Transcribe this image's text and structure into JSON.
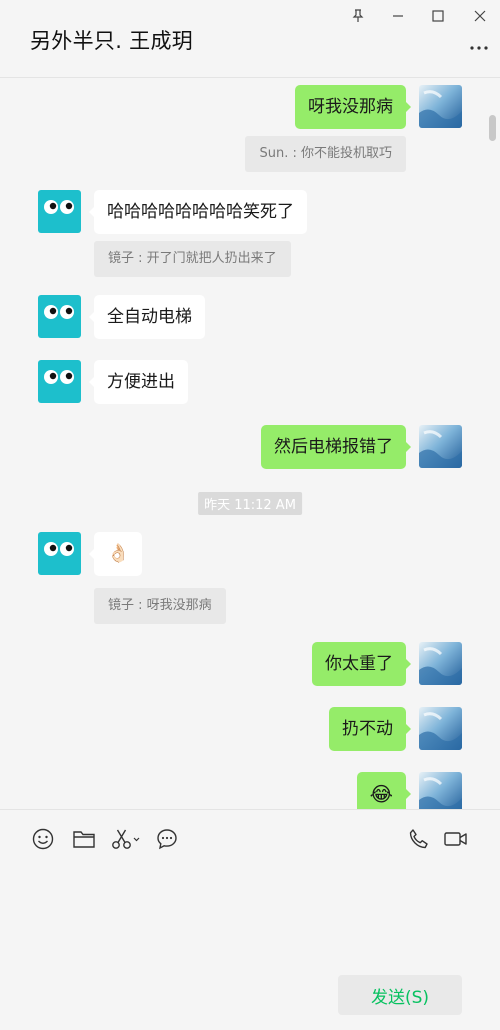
{
  "window": {
    "title": "另外半只. 王成玥"
  },
  "messages": [
    {
      "side": "out",
      "text": "呀我没那病"
    },
    {
      "type": "quote",
      "side": "out",
      "text": "Sun. : 你不能投机取巧"
    },
    {
      "side": "in",
      "text": "哈哈哈哈哈哈哈哈笑死了"
    },
    {
      "type": "quote",
      "side": "in",
      "text": "镜子 : 开了门就把人扔出来了"
    },
    {
      "side": "in",
      "text": "全自动电梯"
    },
    {
      "side": "in",
      "text": "方便进出"
    },
    {
      "side": "out",
      "text": "然后电梯报错了"
    },
    {
      "type": "time",
      "text": "昨天 11:12 AM"
    },
    {
      "side": "in",
      "text": "👌🏻"
    },
    {
      "type": "quote",
      "side": "in",
      "text": "镜子 : 呀我没那病"
    },
    {
      "side": "out",
      "text": "你太重了"
    },
    {
      "side": "out",
      "text": "扔不动"
    },
    {
      "side": "out",
      "text": "😂"
    }
  ],
  "toolbar": {
    "icons": [
      "emoji-icon",
      "folder-icon",
      "scissors-icon",
      "chat-bubble-icon",
      "phone-icon",
      "video-icon"
    ]
  },
  "composer": {
    "send_label": "发送(S)"
  },
  "colors": {
    "outgoing_bubble": "#95ec69",
    "incoming_bubble": "#ffffff",
    "send_text": "#07c160",
    "contact_avatar": "#1dbfcc"
  }
}
